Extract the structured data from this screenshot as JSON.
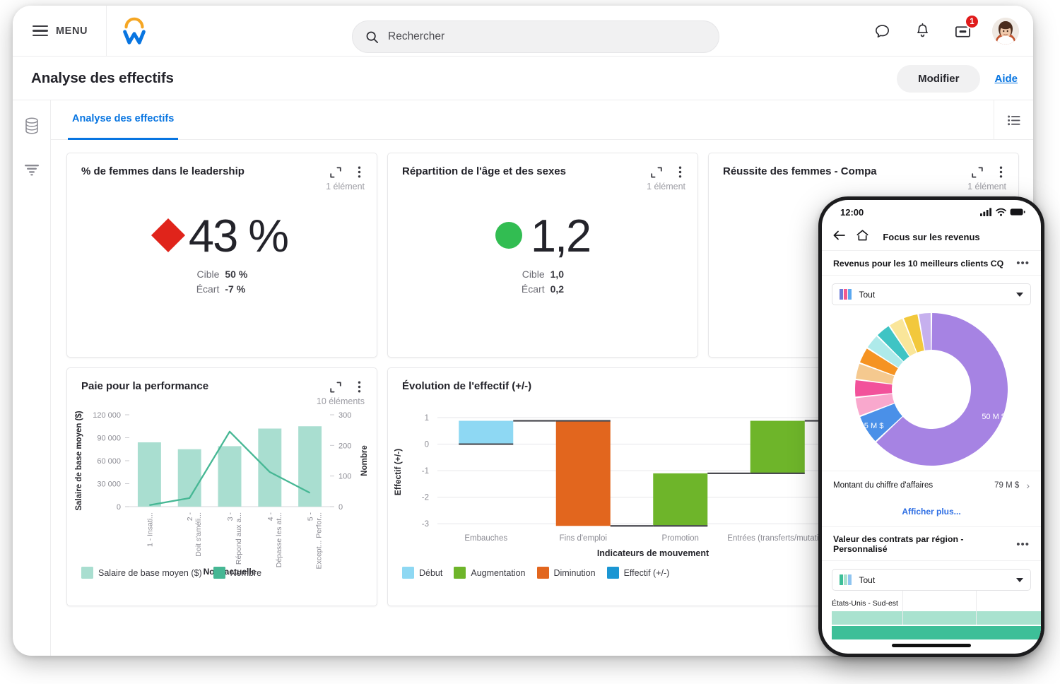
{
  "header": {
    "menu_label": "MENU",
    "logo_name": "workday-logo",
    "search_placeholder": "Rechercher",
    "search_value": "",
    "notification_badge": "1",
    "icons": [
      "search-icon",
      "chat-icon",
      "bell-icon",
      "inbox-icon",
      "avatar"
    ]
  },
  "page": {
    "title": "Analyse des effectifs",
    "edit_label": "Modifier",
    "help_label": "Aide"
  },
  "rail": {
    "items": [
      "database-icon",
      "filter-icon"
    ]
  },
  "tabs": [
    {
      "label": "Analyse des effectifs",
      "active": true
    }
  ],
  "cards": {
    "kpi1": {
      "title": "% de femmes dans le leadership",
      "count": "1 élément",
      "indicator": "diamond",
      "indicator_color": "#e0241b",
      "value": "43 %",
      "target_label": "Cible",
      "target_value": "50 %",
      "gap_label": "Écart",
      "gap_value": "-7 %"
    },
    "kpi2": {
      "title": "Répartition de l'âge et des sexes",
      "count": "1 élément",
      "indicator": "circle",
      "indicator_color": "#32bd52",
      "value": "1,2",
      "target_label": "Cible",
      "target_value": "1,0",
      "gap_label": "Écart",
      "gap_value": "0,2"
    },
    "kpi3": {
      "title": "Réussite des femmes - Compa",
      "count": "1 élément"
    },
    "pay": {
      "title": "Paie pour la performance",
      "count": "10 éléments"
    },
    "water": {
      "title": "Évolution de l'effectif (+/-)"
    }
  },
  "chart_data": [
    {
      "type": "bar",
      "title": "Paie pour la performance",
      "xlabel": "Note actuelle",
      "ylabel": "Salaire de base moyen ($)",
      "y2label": "Nombre",
      "categories": [
        "1 - Insati...",
        "2 - Doit s'améli...",
        "3 - Répond aux a...",
        "4 - Dépasse les at...",
        "5 - Except... Perfor..."
      ],
      "yticks": [
        "0",
        "30 000",
        "60 000",
        "90 000",
        "120 000"
      ],
      "y2ticks": [
        "0",
        "100",
        "200",
        "300"
      ],
      "ylim": [
        0,
        120000
      ],
      "y2lim": [
        0,
        300
      ],
      "grid": false,
      "series": [
        {
          "name": "Salaire de base moyen ($)",
          "type": "bar",
          "color": "#a9ded0",
          "axis": "left",
          "values": [
            84000,
            75000,
            79000,
            102000,
            105000
          ]
        },
        {
          "name": "Nombre",
          "type": "line",
          "color": "#46b794",
          "axis": "right",
          "values": [
            5,
            28,
            245,
            113,
            45
          ]
        }
      ],
      "legend": [
        "Salaire de base moyen ($)",
        "Nombre"
      ],
      "legend_position": "bottom"
    },
    {
      "type": "bar",
      "title": "Évolution de l'effectif (+/-)",
      "xlabel": "Indicateurs de mouvement",
      "ylabel": "Effectif (+/-)",
      "categories": [
        "Embauches",
        "Fins d'emploi",
        "Promotion",
        "Entrées (transferts/mutation"
      ],
      "yticks": [
        "-3",
        "-2",
        "-1",
        "0",
        "1"
      ],
      "ylim": [
        -3.1,
        1
      ],
      "grid": true,
      "waterfall": [
        {
          "label": "Embauches",
          "kind": "Début",
          "color": "#8ed8f3",
          "from": 0,
          "to": 0.88
        },
        {
          "label": "Fins d'emploi",
          "kind": "Diminution",
          "color": "#e2661e",
          "from": 0.88,
          "to": -3.08
        },
        {
          "label": "Promotion",
          "kind": "Augmentation",
          "color": "#6eb52a",
          "from": -3.08,
          "to": -1.1
        },
        {
          "label": "Entrées (transferts/mutation",
          "kind": "Augmentation",
          "color": "#6eb52a",
          "from": -1.1,
          "to": 0.88
        }
      ],
      "legend": [
        {
          "label": "Début",
          "color": "#8ed8f3"
        },
        {
          "label": "Augmentation",
          "color": "#6eb52a"
        },
        {
          "label": "Diminution",
          "color": "#e2661e"
        },
        {
          "label": "Effectif (+/-)",
          "color": "#1b96d3"
        }
      ],
      "legend_position": "bottom"
    },
    {
      "type": "pie",
      "title": "Revenus pour les 10 meilleurs clients CQ",
      "labels": [
        "50 M $",
        "5 M $"
      ],
      "slices": [
        {
          "value": 50,
          "label": "50 M $",
          "color": "#a683e3"
        },
        {
          "value": 5,
          "label": "5 M $",
          "color": "#4a90e8"
        },
        {
          "value": 3.2,
          "label": "",
          "color": "#f9a8cd"
        },
        {
          "value": 3.0,
          "label": "",
          "color": "#f2529b"
        },
        {
          "value": 2.8,
          "label": "",
          "color": "#f5c98f"
        },
        {
          "value": 2.8,
          "label": "",
          "color": "#f59322"
        },
        {
          "value": 2.6,
          "label": "",
          "color": "#aeeaea"
        },
        {
          "value": 2.6,
          "label": "",
          "color": "#3fc4c4"
        },
        {
          "value": 2.6,
          "label": "",
          "color": "#fae69a"
        },
        {
          "value": 2.6,
          "label": "",
          "color": "#f2c83c"
        },
        {
          "value": 2.2,
          "label": "",
          "color": "#c6b0ee"
        }
      ]
    },
    {
      "type": "bar",
      "title": "Valeur des contrats par région - Personnalisé",
      "categories": [
        "États-Unis - Sud-est"
      ],
      "series": [
        {
          "name": "bar-light",
          "color": "#a9e2cf",
          "values": [
            0.94
          ]
        },
        {
          "name": "bar-dark",
          "color": "#3dbf98",
          "values": [
            0.99
          ]
        }
      ]
    }
  ],
  "phone": {
    "status_time": "12:00",
    "nav_title": "Focus sur les revenus",
    "section1_title": "Revenus pour les 10 meilleurs clients CQ",
    "select1_value": "Tout",
    "donut_big_label": "50 M $",
    "donut_small_label": "5 M $",
    "revenue_row_label": "Montant du chiffre d'affaires",
    "revenue_row_value": "79 M $",
    "show_more": "Afficher plus...",
    "section2_title": "Valeur des contrats par région - Personnalisé",
    "select2_value": "Tout",
    "region_label": "États-Unis - Sud-est"
  }
}
